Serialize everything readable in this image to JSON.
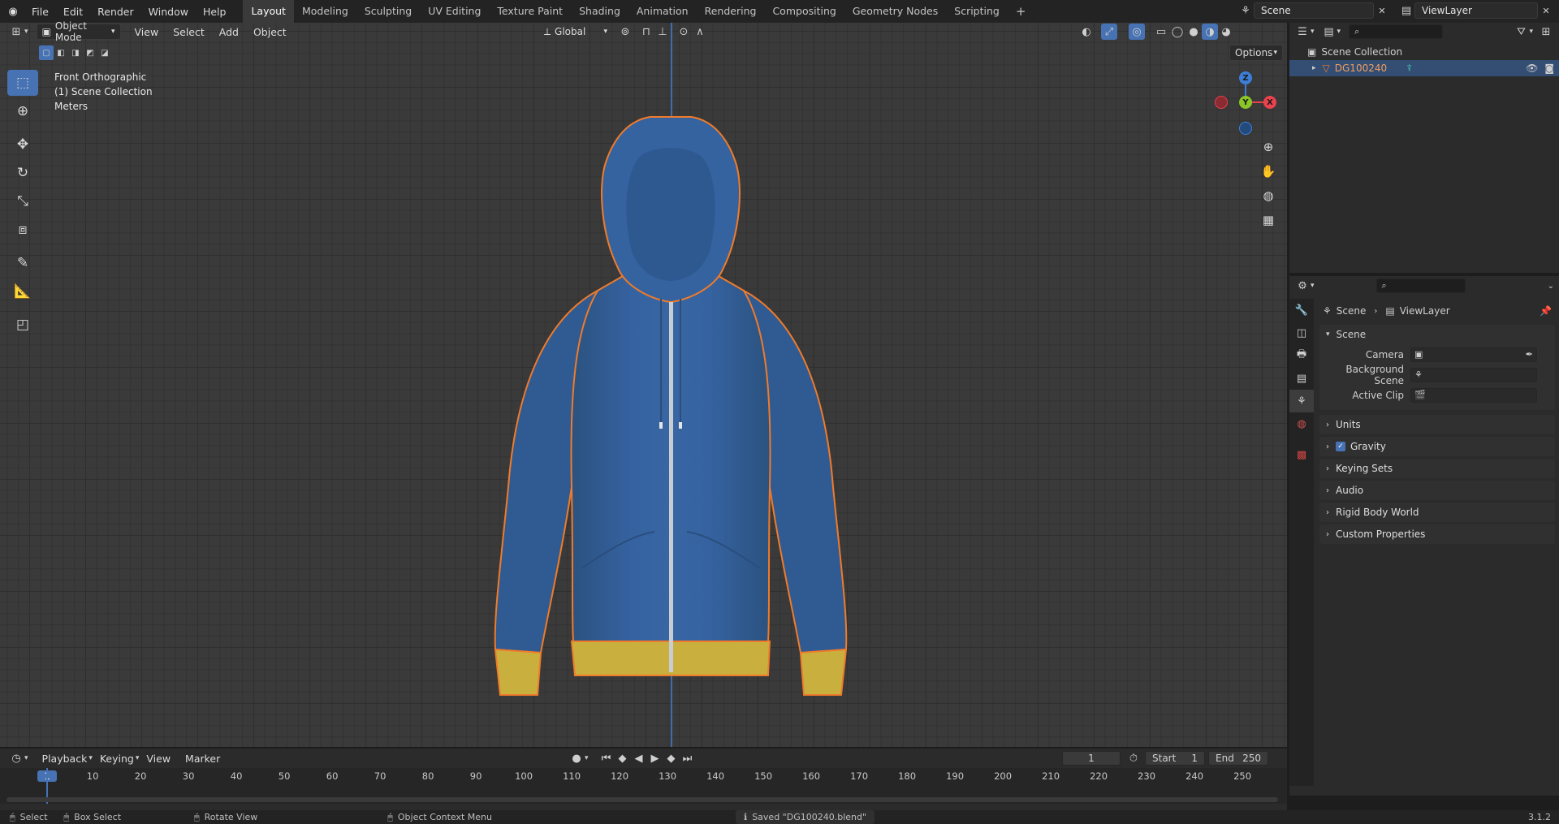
{
  "topbar": {
    "menus": [
      "File",
      "Edit",
      "Render",
      "Window",
      "Help"
    ],
    "workspaces": [
      "Layout",
      "Modeling",
      "Sculpting",
      "UV Editing",
      "Texture Paint",
      "Shading",
      "Animation",
      "Rendering",
      "Compositing",
      "Geometry Nodes",
      "Scripting"
    ],
    "active_workspace": "Layout",
    "scene_name": "Scene",
    "view_layer": "ViewLayer"
  },
  "viewport_header": {
    "mode": "Object Mode",
    "menus": [
      "View",
      "Select",
      "Add",
      "Object"
    ],
    "transform_orientation": "Global",
    "options_label": "Options"
  },
  "viewport_overlay": {
    "view_name": "Front Orthographic",
    "collection": "(1) Scene Collection",
    "units": "Meters"
  },
  "gizmo": {
    "x": "X",
    "y": "Y",
    "z": "Z"
  },
  "outliner": {
    "root": "Scene Collection",
    "object": "DG100240"
  },
  "properties": {
    "breadcrumb_scene": "Scene",
    "breadcrumb_layer": "ViewLayer",
    "panel_scene": "Scene",
    "camera_label": "Camera",
    "background_label": "Background Scene",
    "clip_label": "Active Clip",
    "collapsed_panels": [
      "Units",
      "Gravity",
      "Keying Sets",
      "Audio",
      "Rigid Body World",
      "Custom Properties"
    ],
    "gravity_checked": true
  },
  "timeline": {
    "menus": [
      "Playback",
      "Keying",
      "View",
      "Marker"
    ],
    "current_frame": "1",
    "start_label": "Start",
    "start": "1",
    "end_label": "End",
    "end": "250",
    "ticks": [
      "1",
      "10",
      "20",
      "30",
      "40",
      "50",
      "60",
      "70",
      "80",
      "90",
      "100",
      "110",
      "120",
      "130",
      "140",
      "150",
      "160",
      "170",
      "180",
      "190",
      "200",
      "210",
      "220",
      "230",
      "240",
      "250"
    ]
  },
  "statusbar": {
    "select": "Select",
    "box_select": "Box Select",
    "rotate_view": "Rotate View",
    "context_menu": "Object Context Menu",
    "message": "Saved \"DG100240.blend\"",
    "version": "3.1.2"
  },
  "colors": {
    "accent": "#4772b3",
    "hoodie": "#345f94",
    "ribbing": "#c9b03e",
    "selection_outline": "#f07b2a",
    "axis_x": "#e8424c",
    "axis_y": "#8ac625",
    "axis_z": "#3d7fd8"
  }
}
